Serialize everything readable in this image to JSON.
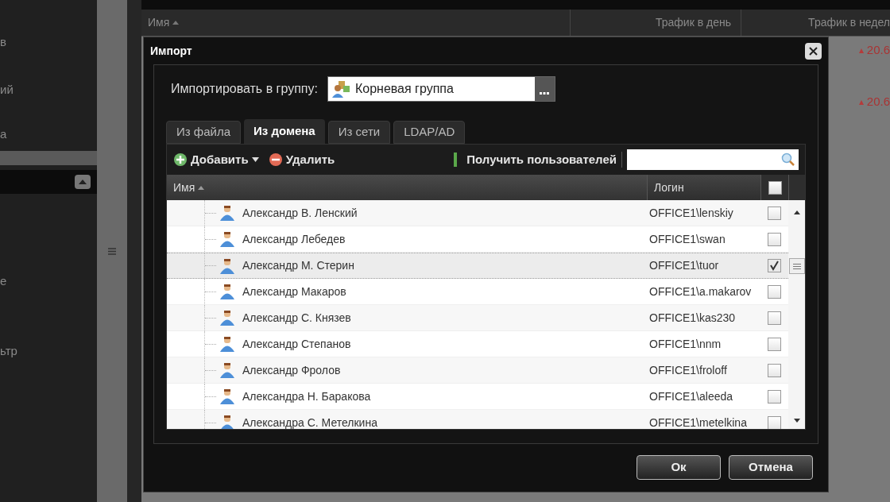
{
  "background": {
    "sidebar_fragments": [
      "в",
      "ий",
      "а",
      "е",
      "ьтр"
    ],
    "table": {
      "columns": [
        "Имя",
        "Трафик в день",
        "Трафик в недел"
      ],
      "values": [
        "20.6",
        "20.6"
      ]
    }
  },
  "dialog": {
    "title": "Импорт",
    "group_label": "Импортировать в группу:",
    "group_value": "Корневая группа",
    "tabs": [
      {
        "label": "Из файла",
        "selected": false
      },
      {
        "label": "Из домена",
        "selected": true
      },
      {
        "label": "Из сети",
        "selected": false
      },
      {
        "label": "LDAP/AD",
        "selected": false
      }
    ],
    "toolbar": {
      "add": "Добавить",
      "remove": "Удалить",
      "fetch": "Получить пользователей"
    },
    "columns": [
      "Имя",
      "Логин"
    ],
    "header_checked": false,
    "rows": [
      {
        "name": "Александр В. Ленский",
        "login": "OFFICE1\\lenskiy",
        "checked": false,
        "selected": false
      },
      {
        "name": "Александр Лебедев",
        "login": "OFFICE1\\swan",
        "checked": false,
        "selected": false
      },
      {
        "name": "Александр М. Стерин",
        "login": "OFFICE1\\tuor",
        "checked": true,
        "selected": true
      },
      {
        "name": "Александр Макаров",
        "login": "OFFICE1\\a.makarov",
        "checked": false,
        "selected": false
      },
      {
        "name": "Александр С. Князев",
        "login": "OFFICE1\\kas230",
        "checked": false,
        "selected": false
      },
      {
        "name": "Александр Степанов",
        "login": "OFFICE1\\nnm",
        "checked": false,
        "selected": false
      },
      {
        "name": "Александр Фролов",
        "login": "OFFICE1\\froloff",
        "checked": false,
        "selected": false
      },
      {
        "name": "Александра Н. Баракова",
        "login": "OFFICE1\\aleeda",
        "checked": false,
        "selected": false
      },
      {
        "name": "Александра С. Метелкина",
        "login": "OFFICE1\\metelkina",
        "checked": false,
        "selected": false
      }
    ],
    "buttons": [
      "Ок",
      "Отмена"
    ]
  }
}
